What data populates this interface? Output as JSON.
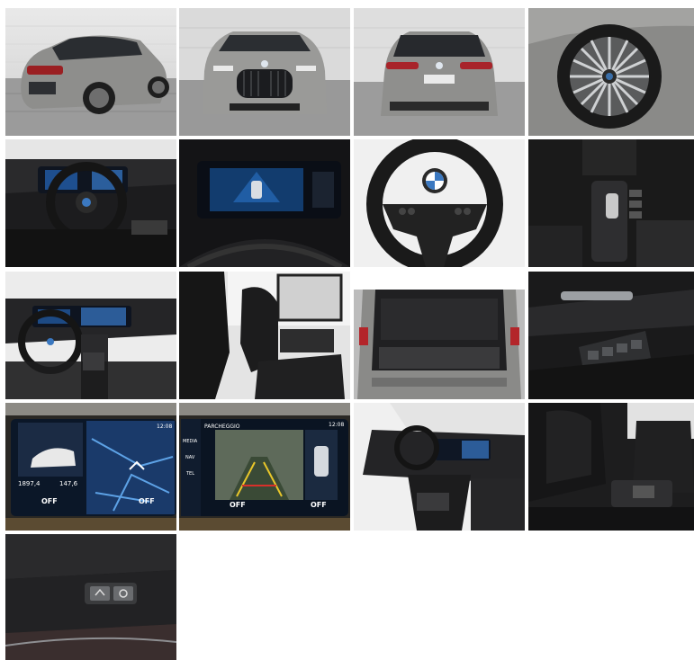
{
  "gallery": {
    "photos": [
      {
        "subject": "car rear three-quarter view"
      },
      {
        "subject": "car front view"
      },
      {
        "subject": "car rear view"
      },
      {
        "subject": "alloy wheel close-up"
      },
      {
        "subject": "cockpit and steering wheel"
      },
      {
        "subject": "digital instrument display"
      },
      {
        "subject": "multifunction steering wheel"
      },
      {
        "subject": "center console controls"
      },
      {
        "subject": "dashboard overview"
      },
      {
        "subject": "front seats"
      },
      {
        "subject": "open trunk"
      },
      {
        "subject": "door window switches"
      },
      {
        "subject": "infotainment navigation screen"
      },
      {
        "subject": "parking camera screen"
      },
      {
        "subject": "interior passenger side"
      },
      {
        "subject": "rear seats armrest"
      },
      {
        "subject": "tailgate buttons"
      }
    ],
    "screen_nav": {
      "distance": "1897,4",
      "range": "147,6",
      "off_left": "OFF",
      "off_right": "OFF",
      "time": "12:08"
    },
    "screen_park": {
      "title": "PARCHEGGIO",
      "menu_media": "MEDIA",
      "menu_nav": "NAV",
      "menu_tel": "TEL",
      "off_left": "OFF",
      "off_right": "OFF",
      "time": "12:08"
    }
  }
}
